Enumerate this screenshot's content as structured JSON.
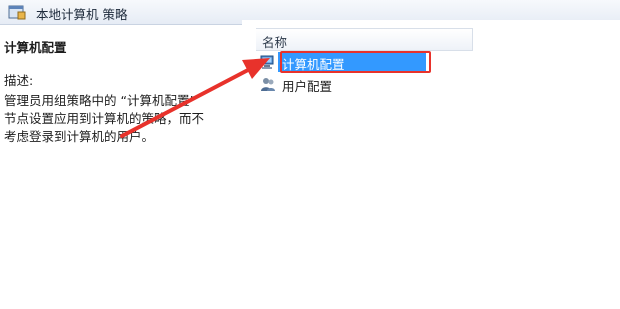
{
  "window": {
    "title": "本地计算机 策略"
  },
  "left": {
    "section_title": "计算机配置",
    "description_label": "描述:",
    "description_lines": [
      "管理员用组策略中的 “计算机配置”",
      "节点设置应用到计算机的策略，而不",
      "考虑登录到计算机的用户。"
    ]
  },
  "list": {
    "column_header": "名称",
    "items": [
      {
        "label": "计算机配置",
        "icon": "computer-icon",
        "selected": true
      },
      {
        "label": "用户配置",
        "icon": "users-icon",
        "selected": false
      }
    ]
  },
  "annotation": {
    "highlight_color": "#e8322b",
    "selection_color": "#3399ff"
  }
}
